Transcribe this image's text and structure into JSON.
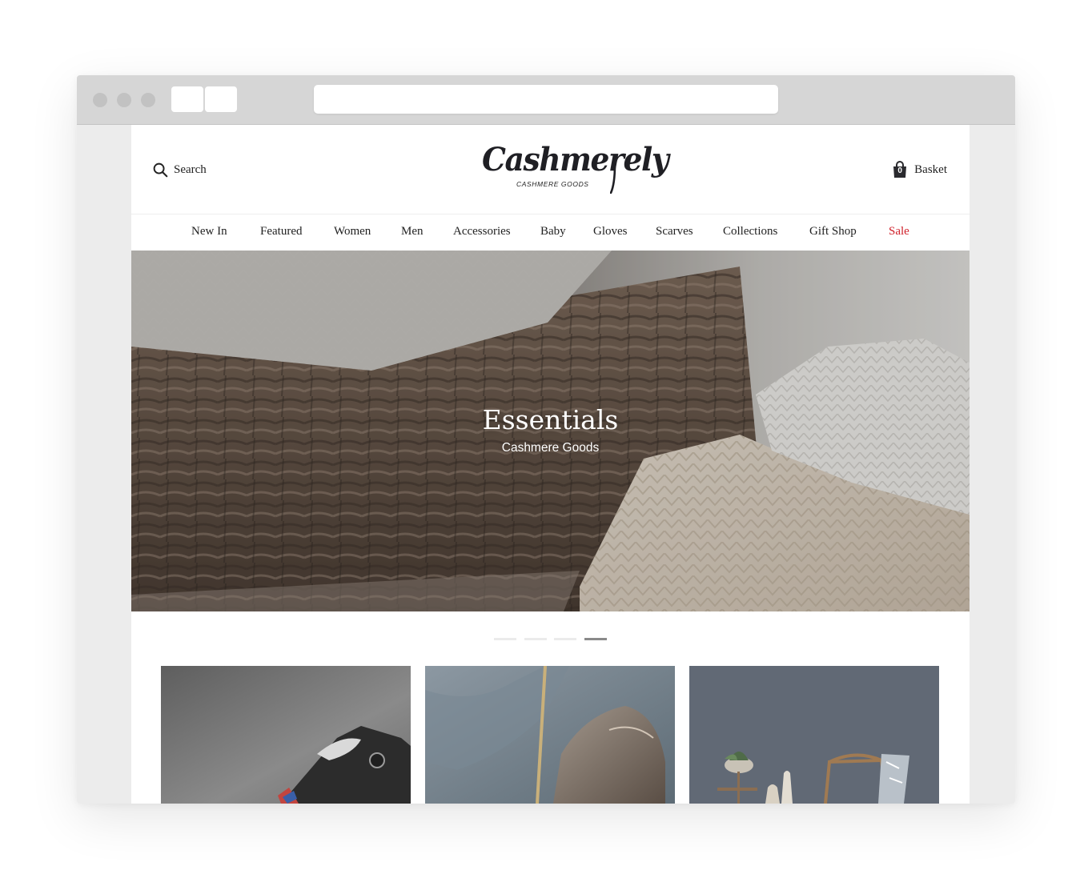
{
  "header": {
    "search_label": "Search",
    "logo_text": "Cashmerely",
    "logo_tagline": "CASHMERE GOODS",
    "basket_label": "Basket",
    "basket_count": "0"
  },
  "nav": {
    "items": [
      {
        "label": "New In"
      },
      {
        "label": "Featured"
      },
      {
        "label": "Women"
      },
      {
        "label": "Men"
      },
      {
        "label": "Accessories"
      },
      {
        "label": "Baby"
      },
      {
        "label": "Gloves"
      },
      {
        "label": "Scarves"
      },
      {
        "label": "Collections"
      },
      {
        "label": "Gift Shop"
      },
      {
        "label": "Sale"
      }
    ]
  },
  "hero": {
    "title": "Essentials",
    "subtitle": "Cashmere Goods"
  },
  "slider": {
    "count": 4,
    "active_index": 3
  },
  "colors": {
    "sale": "#d0202a",
    "text": "#222222",
    "active_dot": "#8a8a8a"
  }
}
